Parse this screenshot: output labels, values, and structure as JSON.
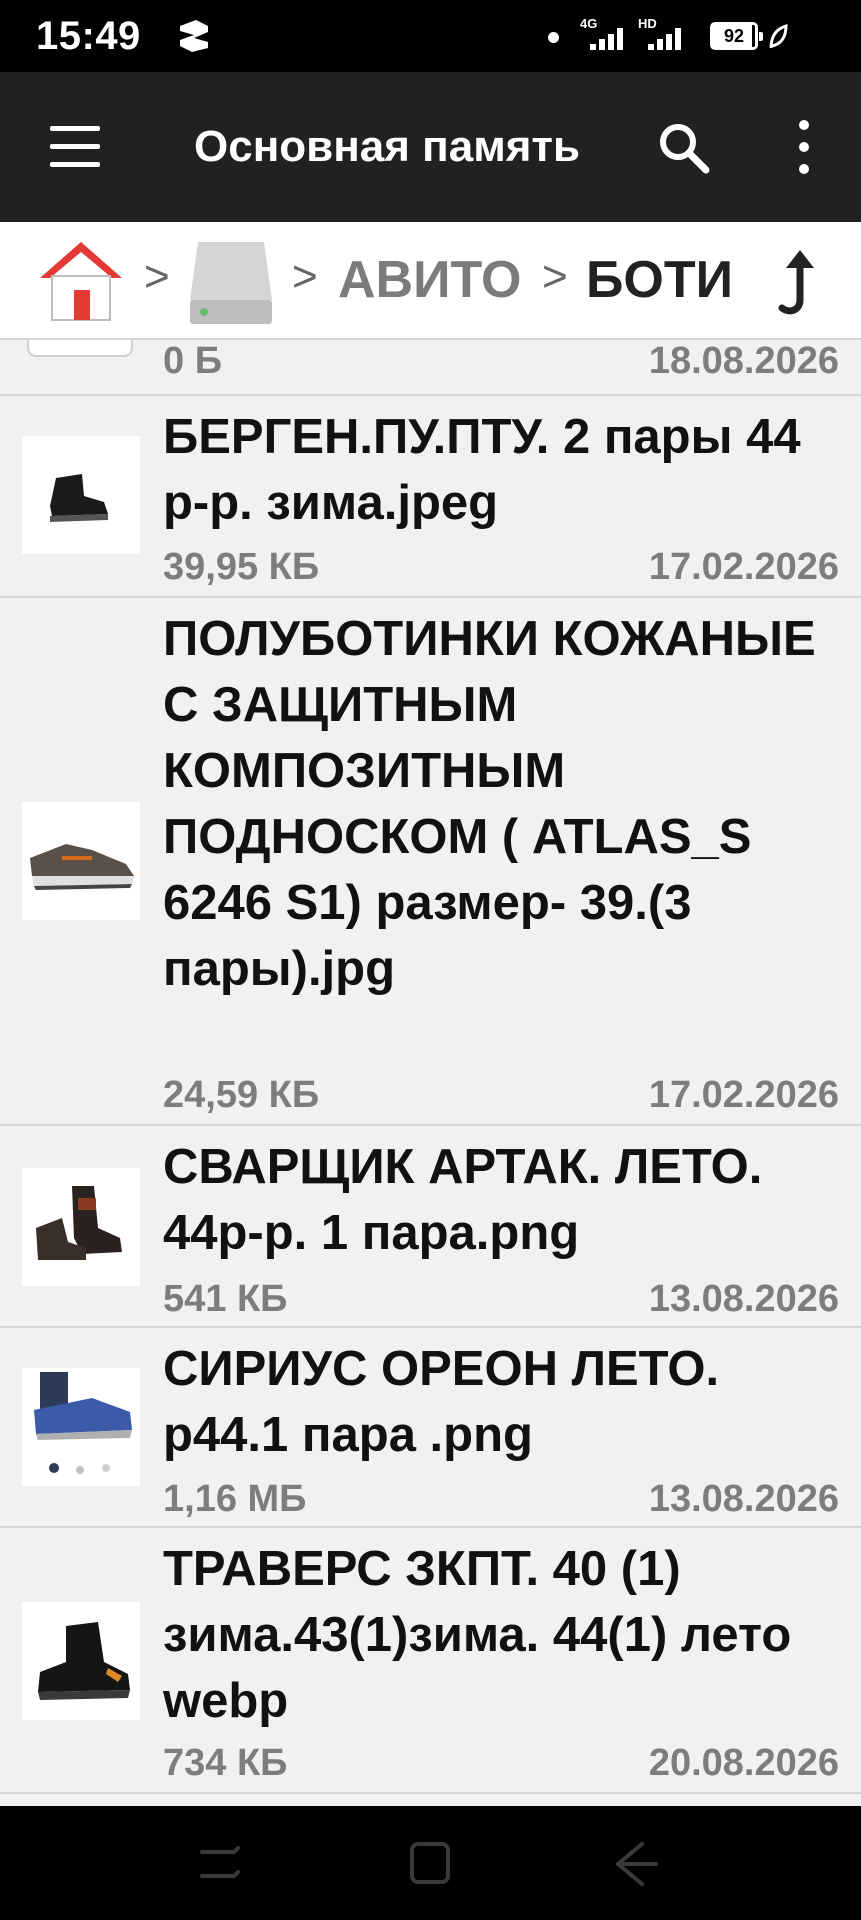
{
  "status_bar": {
    "time": "15:49",
    "network_1": "4G",
    "network_2": "HD",
    "battery": "92",
    "battery_level": 0.92
  },
  "toolbar": {
    "title": "Основная память",
    "menu_icon": "hamburger-menu-icon",
    "search_icon": "search-icon",
    "more_icon": "more-vertical-icon"
  },
  "breadcrumb": {
    "home_icon": "home-icon",
    "drive_icon": "storage-drive-icon",
    "separator": ">",
    "items": [
      "АВИТО",
      "БОТИ"
    ],
    "up_icon": "up-arrow-icon"
  },
  "files": [
    {
      "name": "",
      "size": "0 Б",
      "date": "18.08.2026",
      "thumb": "folder-icon"
    },
    {
      "name": "БЕРГЕН.ПУ.ПТУ.  2 пары 44 р-р. зима.jpeg",
      "size": "39,95 КБ",
      "date": "17.02.2026",
      "thumb": "boot-black-image"
    },
    {
      "name": "ПОЛУБОТИНКИ КОЖАНЫЕ С ЗАЩИТНЫМ КОМПОЗИТНЫМ ПОДНОСКОМ ( ATLAS_S 6246 S1) размер- 39.(3 пары).jpg",
      "size": "24,59 КБ",
      "date": "17.02.2026",
      "thumb": "shoe-grey-image"
    },
    {
      "name": "СВАРЩИК АРТАК. ЛЕТО. 44р-р. 1 пара.png",
      "size": "541 КБ",
      "date": "13.08.2026",
      "thumb": "boot-welder-image"
    },
    {
      "name": "СИРИУС ОРЕОН ЛЕТО. р44.1 пара .png",
      "size": "1,16 МБ",
      "date": "13.08.2026",
      "thumb": "shoe-blue-image"
    },
    {
      "name": "ТРАВЕРС ЗКПТ. 40 (1) зима.43(1)зима. 44(1) лето webp",
      "size": "734 КБ",
      "date": "20.08.2026",
      "thumb": "boot-travers-image"
    }
  ],
  "nav_bar": {
    "recents_icon": "recents-icon",
    "home_icon": "square-home-icon",
    "back_icon": "back-icon"
  },
  "colors": {
    "toolbar": "#212121",
    "list_background": "#f1f1f1",
    "meta_text": "#7d7d7d",
    "home_roof": "#e53935"
  }
}
